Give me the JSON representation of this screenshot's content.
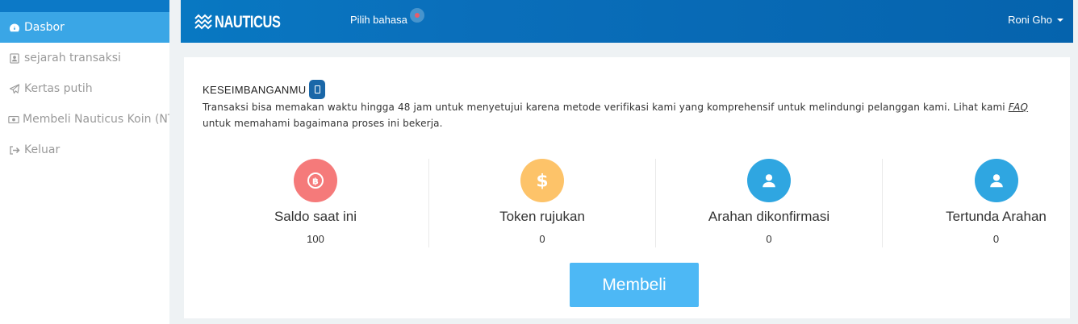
{
  "sidebar": {
    "items": [
      {
        "label": "Dasbor",
        "icon": "dashboard-icon",
        "active": true
      },
      {
        "label": "sejarah transaksi",
        "icon": "contact-card-icon",
        "active": false
      },
      {
        "label": "Kertas putih",
        "icon": "paper-plane-icon",
        "active": false
      },
      {
        "label": "Membeli Nauticus Koin (NTC)",
        "icon": "money-icon",
        "active": false
      },
      {
        "label": "Keluar",
        "icon": "sign-out-icon",
        "active": false
      }
    ]
  },
  "header": {
    "logo_text": "NAUTICUS",
    "language_label": "Pilih bahasa",
    "user_name": "Roni Gho"
  },
  "balance": {
    "title": "KESEIMBANGANMU",
    "description_text": "Transaksi bisa memakan waktu hingga 48 jam untuk menyetujui karena metode verifikasi kami yang komprehensif untuk melindungi pelanggan kami. Lihat kami ",
    "faq_link": "FAQ",
    "description_tail": " untuk memahami bagaimana proses ini bekerja.",
    "stats": [
      {
        "label": "Saldo saat ini",
        "value": "100",
        "icon": "bitcoin-icon",
        "color": "#f57a7a"
      },
      {
        "label": "Token rujukan",
        "value": "0",
        "icon": "dollar-icon",
        "color": "#fdc369"
      },
      {
        "label": "Arahan dikonfirmasi",
        "value": "0",
        "icon": "user-icon",
        "color": "#2fa6e1"
      },
      {
        "label": "Tertunda Arahan",
        "value": "0",
        "icon": "user-icon",
        "color": "#2fa6e1"
      }
    ],
    "buy_label": "Membeli"
  },
  "colors": {
    "header_blue": "#0878c2",
    "sidebar_active": "#3aa6e6",
    "button_blue": "#4db8f5"
  }
}
